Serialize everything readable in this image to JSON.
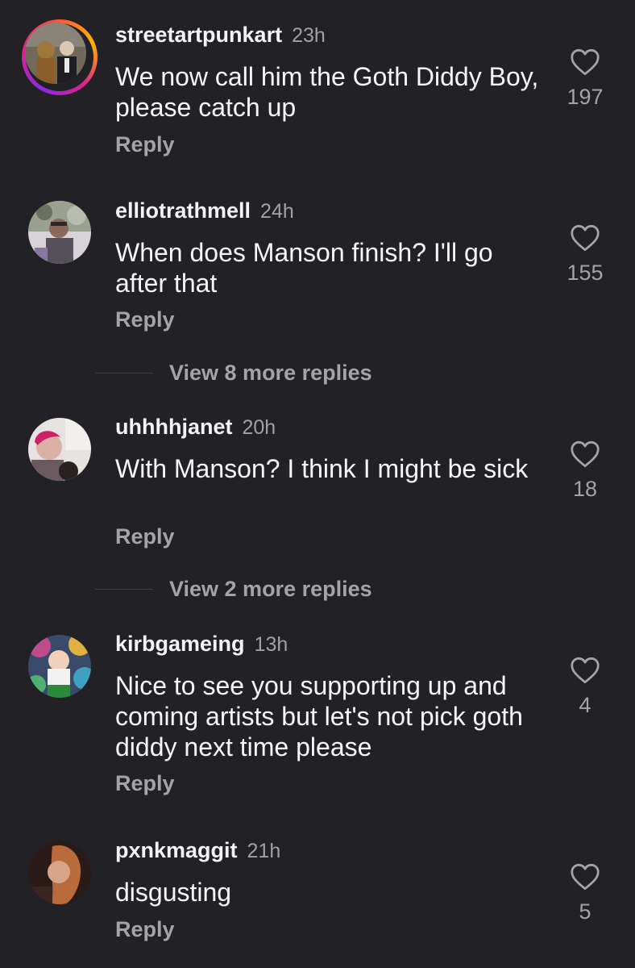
{
  "comments": [
    {
      "username": "streetartpunkart",
      "time": "23h",
      "text": "We now call him the Goth Diddy Boy, please catch up",
      "reply": "Reply",
      "likes": "197",
      "avatar_icon": "avatar-photo",
      "has_story_ring": true
    },
    {
      "username": "elliotrathmell",
      "time": "24h",
      "text": "When does Manson finish? I'll go after that",
      "reply": "Reply",
      "likes": "155",
      "avatar_icon": "avatar-photo"
    },
    {
      "username": "uhhhhjanet",
      "time": "20h",
      "text": "With Manson? I think I might be sick",
      "reply": "Reply",
      "likes": "18",
      "avatar_icon": "avatar-photo"
    },
    {
      "username": "kirbgameing",
      "time": "13h",
      "text": "Nice to see you supporting up and coming artists but let's not pick goth diddy next time please",
      "reply": "Reply",
      "likes": "4",
      "avatar_icon": "avatar-photo"
    },
    {
      "username": "pxnkmaggit",
      "time": "21h",
      "text": "disgusting",
      "reply": "Reply",
      "likes": "5",
      "avatar_icon": "avatar-photo"
    }
  ],
  "view_more": [
    {
      "label": "View 8 more replies"
    },
    {
      "label": "View 2 more replies"
    }
  ],
  "icons": {
    "like": "heart-outline-icon"
  },
  "colors": {
    "background": "#212126",
    "text": "#f6f6f6",
    "muted": "#a3a3a8"
  }
}
